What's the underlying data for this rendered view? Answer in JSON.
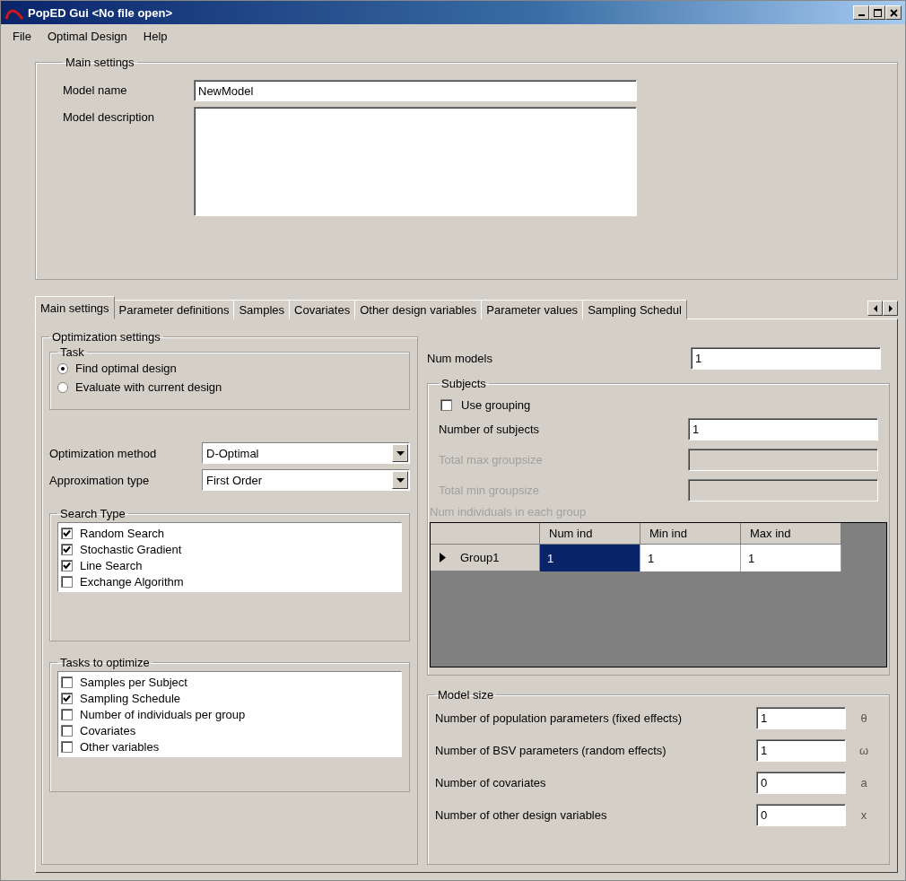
{
  "window": {
    "title": "PopED Gui <No file open>"
  },
  "menu": [
    "File",
    "Optimal Design",
    "Help"
  ],
  "main_settings": {
    "legend": "Main settings",
    "model_name": {
      "label": "Model name",
      "value": "NewModel"
    },
    "model_description": {
      "label": "Model description"
    }
  },
  "tabs": [
    {
      "label": "Main settings",
      "selected": true
    },
    {
      "label": "Parameter definitions",
      "selected": false
    },
    {
      "label": "Samples",
      "selected": false
    },
    {
      "label": "Covariates",
      "selected": false
    },
    {
      "label": "Other design variables",
      "selected": false
    },
    {
      "label": "Parameter values",
      "selected": false
    },
    {
      "label": "Sampling Schedul",
      "selected": false
    }
  ],
  "optimization_settings": {
    "legend": "Optimization settings",
    "task": {
      "legend": "Task",
      "options": [
        {
          "label": "Find optimal design",
          "selected": true
        },
        {
          "label": "Evaluate with current design",
          "selected": false
        }
      ]
    },
    "optimization_method": {
      "label": "Optimization method",
      "value": "D-Optimal"
    },
    "approximation_type": {
      "label": "Approximation type",
      "value": "First Order"
    },
    "search_type": {
      "legend": "Search Type",
      "items": [
        {
          "label": "Random Search",
          "checked": true
        },
        {
          "label": "Stochastic Gradient",
          "checked": true
        },
        {
          "label": "Line Search",
          "checked": true
        },
        {
          "label": "Exchange Algorithm",
          "checked": false
        }
      ]
    },
    "tasks_to_optimize": {
      "legend": "Tasks to optimize",
      "items": [
        {
          "label": "Samples per Subject",
          "checked": false
        },
        {
          "label": "Sampling Schedule",
          "checked": true
        },
        {
          "label": "Number of individuals per group",
          "checked": false
        },
        {
          "label": "Covariates",
          "checked": false
        },
        {
          "label": "Other variables",
          "checked": false
        }
      ]
    }
  },
  "num_models": {
    "label": "Num models",
    "value": "1"
  },
  "subjects": {
    "legend": "Subjects",
    "use_grouping": {
      "label": "Use grouping",
      "checked": false
    },
    "fields": [
      {
        "label": "Number of subjects",
        "value": "1",
        "disabled": false
      },
      {
        "label": "Total max groupsize",
        "disabled": true
      },
      {
        "label": "Total min groupsize",
        "disabled": true
      }
    ],
    "grid": {
      "caption": "Num individuals in each group",
      "disabled": true,
      "columns": [
        "Num ind",
        "Min ind",
        "Max ind"
      ],
      "rows": [
        {
          "label": "Group1",
          "current": true,
          "cells": [
            {
              "value": "1",
              "selected": true
            },
            {
              "value": "1",
              "selected": false
            },
            {
              "value": "1",
              "selected": false
            }
          ]
        }
      ]
    }
  },
  "model_size": {
    "legend": "Model size",
    "rows": [
      {
        "label": "Number of population parameters (fixed effects)",
        "value": "1",
        "symbol": "θ"
      },
      {
        "label": "Number of BSV parameters (random effects)",
        "value": "1",
        "symbol": "ω"
      },
      {
        "label": "Number of covariates",
        "value": "0",
        "symbol": "a"
      },
      {
        "label": "Number of other design variables",
        "value": "0",
        "symbol": "x"
      }
    ]
  }
}
